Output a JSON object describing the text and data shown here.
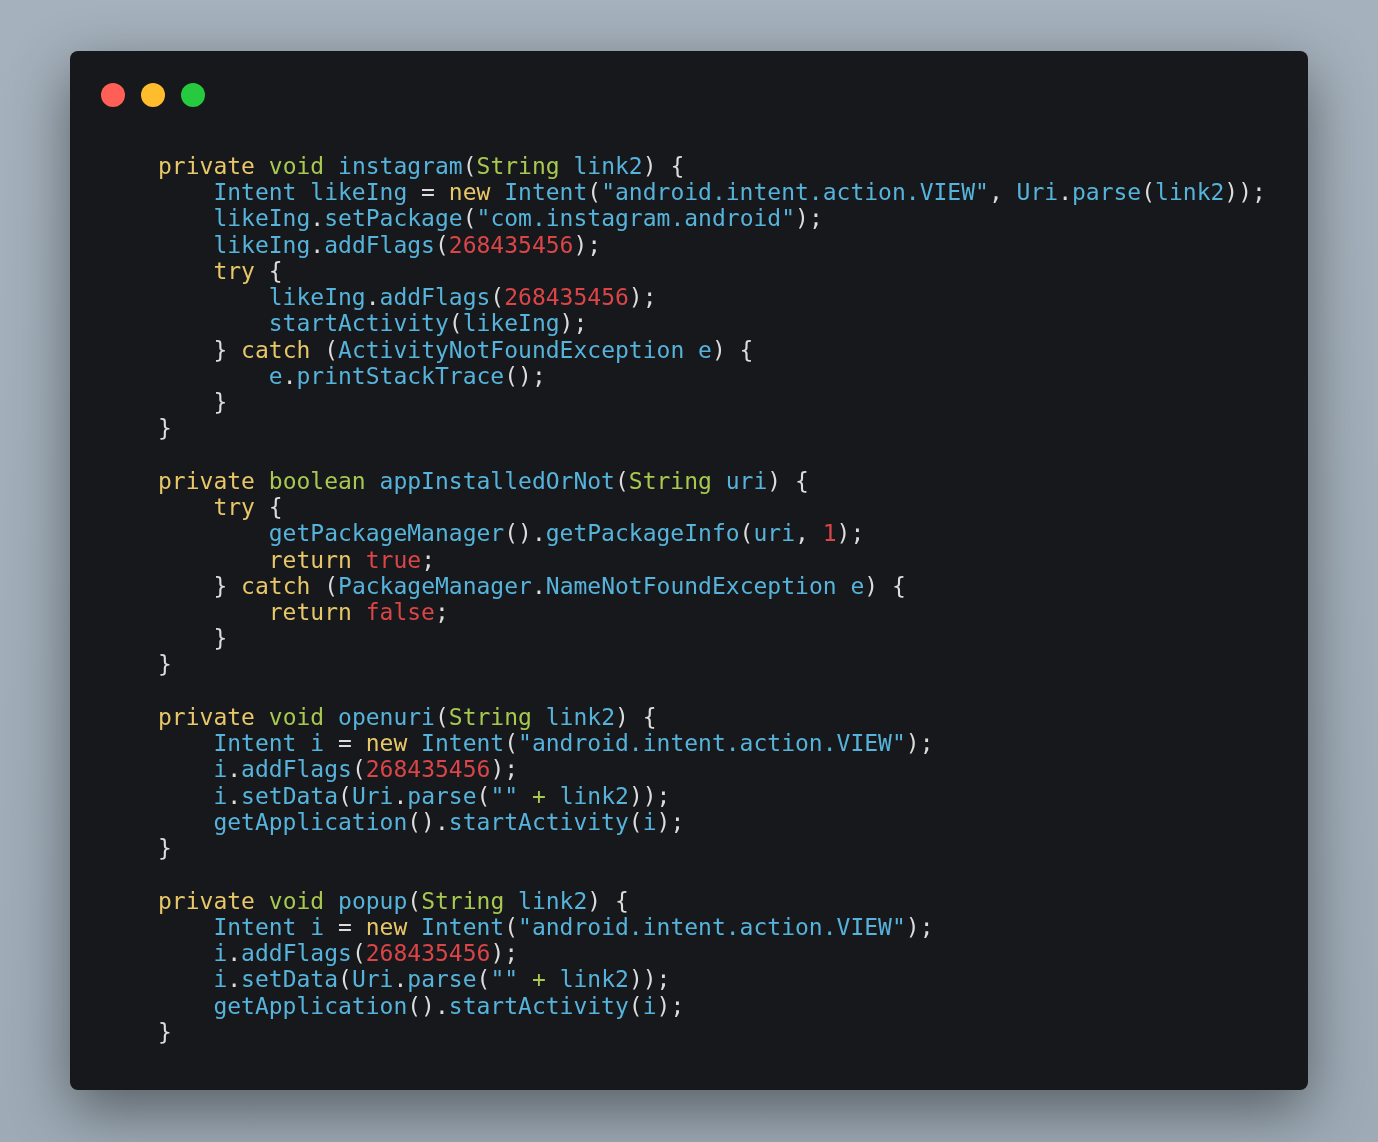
{
  "window": {
    "controls": [
      {
        "color": "#ff5f56"
      },
      {
        "color": "#ffbd2e"
      },
      {
        "color": "#27c93f"
      }
    ]
  },
  "code": {
    "lines": [
      {
        "kind": "code",
        "tokens": [
          {
            "kind": "keyword",
            "text": "private"
          },
          {
            "kind": "type",
            "text": " void"
          },
          {
            "kind": "name",
            "text": " instagram"
          },
          {
            "kind": "punct",
            "text": "("
          },
          {
            "kind": "type",
            "text": "String"
          },
          {
            "kind": "name",
            "text": " link2"
          },
          {
            "kind": "punct",
            "text": ") {"
          }
        ]
      },
      {
        "kind": "code",
        "tokens": [
          {
            "kind": "name",
            "text": "    Intent likeIng"
          },
          {
            "kind": "punct",
            "text": " = "
          },
          {
            "kind": "keyword",
            "text": "new"
          },
          {
            "kind": "name",
            "text": " Intent"
          },
          {
            "kind": "punct",
            "text": "("
          },
          {
            "kind": "string",
            "text": "\"android.intent.action.VIEW\""
          },
          {
            "kind": "punct",
            "text": ", "
          },
          {
            "kind": "name",
            "text": "Uri"
          },
          {
            "kind": "punct",
            "text": "."
          },
          {
            "kind": "name",
            "text": "parse"
          },
          {
            "kind": "punct",
            "text": "("
          },
          {
            "kind": "name",
            "text": "link2"
          },
          {
            "kind": "punct",
            "text": "));"
          }
        ]
      },
      {
        "kind": "code",
        "tokens": [
          {
            "kind": "name",
            "text": "    likeIng"
          },
          {
            "kind": "punct",
            "text": "."
          },
          {
            "kind": "name",
            "text": "setPackage"
          },
          {
            "kind": "punct",
            "text": "("
          },
          {
            "kind": "string",
            "text": "\"com.instagram.android\""
          },
          {
            "kind": "punct",
            "text": ");"
          }
        ]
      },
      {
        "kind": "code",
        "tokens": [
          {
            "kind": "name",
            "text": "    likeIng"
          },
          {
            "kind": "punct",
            "text": "."
          },
          {
            "kind": "name",
            "text": "addFlags"
          },
          {
            "kind": "punct",
            "text": "("
          },
          {
            "kind": "number",
            "text": "268435456"
          },
          {
            "kind": "punct",
            "text": ");"
          }
        ]
      },
      {
        "kind": "code",
        "tokens": [
          {
            "kind": "keyword",
            "text": "    try"
          },
          {
            "kind": "punct",
            "text": " {"
          }
        ]
      },
      {
        "kind": "code",
        "tokens": [
          {
            "kind": "name",
            "text": "        likeIng"
          },
          {
            "kind": "punct",
            "text": "."
          },
          {
            "kind": "name",
            "text": "addFlags"
          },
          {
            "kind": "punct",
            "text": "("
          },
          {
            "kind": "number",
            "text": "268435456"
          },
          {
            "kind": "punct",
            "text": ");"
          }
        ]
      },
      {
        "kind": "code",
        "tokens": [
          {
            "kind": "name",
            "text": "        startActivity"
          },
          {
            "kind": "punct",
            "text": "("
          },
          {
            "kind": "name",
            "text": "likeIng"
          },
          {
            "kind": "punct",
            "text": ");"
          }
        ]
      },
      {
        "kind": "code",
        "tokens": [
          {
            "kind": "punct",
            "text": "    } "
          },
          {
            "kind": "keyword",
            "text": "catch"
          },
          {
            "kind": "punct",
            "text": " ("
          },
          {
            "kind": "name",
            "text": "ActivityNotFoundException e"
          },
          {
            "kind": "punct",
            "text": ") {"
          }
        ]
      },
      {
        "kind": "code",
        "tokens": [
          {
            "kind": "name",
            "text": "        e"
          },
          {
            "kind": "punct",
            "text": "."
          },
          {
            "kind": "name",
            "text": "printStackTrace"
          },
          {
            "kind": "punct",
            "text": "();"
          }
        ]
      },
      {
        "kind": "code",
        "tokens": [
          {
            "kind": "punct",
            "text": "    }"
          }
        ]
      },
      {
        "kind": "code",
        "tokens": [
          {
            "kind": "punct",
            "text": "}"
          }
        ]
      },
      {
        "kind": "blank"
      },
      {
        "kind": "code",
        "tokens": [
          {
            "kind": "keyword",
            "text": "private"
          },
          {
            "kind": "type",
            "text": " boolean"
          },
          {
            "kind": "name",
            "text": " appInstalledOrNot"
          },
          {
            "kind": "punct",
            "text": "("
          },
          {
            "kind": "type",
            "text": "String"
          },
          {
            "kind": "name",
            "text": " uri"
          },
          {
            "kind": "punct",
            "text": ") {"
          }
        ]
      },
      {
        "kind": "code",
        "tokens": [
          {
            "kind": "keyword",
            "text": "    try"
          },
          {
            "kind": "punct",
            "text": " {"
          }
        ]
      },
      {
        "kind": "code",
        "tokens": [
          {
            "kind": "name",
            "text": "        getPackageManager"
          },
          {
            "kind": "punct",
            "text": "()."
          },
          {
            "kind": "name",
            "text": "getPackageInfo"
          },
          {
            "kind": "punct",
            "text": "("
          },
          {
            "kind": "name",
            "text": "uri"
          },
          {
            "kind": "punct",
            "text": ", "
          },
          {
            "kind": "number",
            "text": "1"
          },
          {
            "kind": "punct",
            "text": ");"
          }
        ]
      },
      {
        "kind": "code",
        "tokens": [
          {
            "kind": "keyword",
            "text": "        return"
          },
          {
            "kind": "number",
            "text": " true"
          },
          {
            "kind": "punct",
            "text": ";"
          }
        ]
      },
      {
        "kind": "code",
        "tokens": [
          {
            "kind": "punct",
            "text": "    } "
          },
          {
            "kind": "keyword",
            "text": "catch"
          },
          {
            "kind": "punct",
            "text": " ("
          },
          {
            "kind": "name",
            "text": "PackageManager"
          },
          {
            "kind": "punct",
            "text": "."
          },
          {
            "kind": "name",
            "text": "NameNotFoundException e"
          },
          {
            "kind": "punct",
            "text": ") {"
          }
        ]
      },
      {
        "kind": "code",
        "tokens": [
          {
            "kind": "keyword",
            "text": "        return"
          },
          {
            "kind": "number",
            "text": " false"
          },
          {
            "kind": "punct",
            "text": ";"
          }
        ]
      },
      {
        "kind": "code",
        "tokens": [
          {
            "kind": "punct",
            "text": "    }"
          }
        ]
      },
      {
        "kind": "code",
        "tokens": [
          {
            "kind": "punct",
            "text": "}"
          }
        ]
      },
      {
        "kind": "blank"
      },
      {
        "kind": "code",
        "tokens": [
          {
            "kind": "keyword",
            "text": "private"
          },
          {
            "kind": "type",
            "text": " void"
          },
          {
            "kind": "name",
            "text": " openuri"
          },
          {
            "kind": "punct",
            "text": "("
          },
          {
            "kind": "type",
            "text": "String"
          },
          {
            "kind": "name",
            "text": " link2"
          },
          {
            "kind": "punct",
            "text": ") {"
          }
        ]
      },
      {
        "kind": "code",
        "tokens": [
          {
            "kind": "name",
            "text": "    Intent i"
          },
          {
            "kind": "punct",
            "text": " = "
          },
          {
            "kind": "keyword",
            "text": "new"
          },
          {
            "kind": "name",
            "text": " Intent"
          },
          {
            "kind": "punct",
            "text": "("
          },
          {
            "kind": "string",
            "text": "\"android.intent.action.VIEW\""
          },
          {
            "kind": "punct",
            "text": ");"
          }
        ]
      },
      {
        "kind": "code",
        "tokens": [
          {
            "kind": "name",
            "text": "    i"
          },
          {
            "kind": "punct",
            "text": "."
          },
          {
            "kind": "name",
            "text": "addFlags"
          },
          {
            "kind": "punct",
            "text": "("
          },
          {
            "kind": "number",
            "text": "268435456"
          },
          {
            "kind": "punct",
            "text": ");"
          }
        ]
      },
      {
        "kind": "code",
        "tokens": [
          {
            "kind": "name",
            "text": "    i"
          },
          {
            "kind": "punct",
            "text": "."
          },
          {
            "kind": "name",
            "text": "setData"
          },
          {
            "kind": "punct",
            "text": "("
          },
          {
            "kind": "name",
            "text": "Uri"
          },
          {
            "kind": "punct",
            "text": "."
          },
          {
            "kind": "name",
            "text": "parse"
          },
          {
            "kind": "punct",
            "text": "("
          },
          {
            "kind": "string",
            "text": "\"\""
          },
          {
            "kind": "operator",
            "text": " + "
          },
          {
            "kind": "name",
            "text": "link2"
          },
          {
            "kind": "punct",
            "text": "));"
          }
        ]
      },
      {
        "kind": "code",
        "tokens": [
          {
            "kind": "name",
            "text": "    getApplication"
          },
          {
            "kind": "punct",
            "text": "()."
          },
          {
            "kind": "name",
            "text": "startActivity"
          },
          {
            "kind": "punct",
            "text": "("
          },
          {
            "kind": "name",
            "text": "i"
          },
          {
            "kind": "punct",
            "text": ");"
          }
        ]
      },
      {
        "kind": "code",
        "tokens": [
          {
            "kind": "punct",
            "text": "}"
          }
        ]
      },
      {
        "kind": "blank"
      },
      {
        "kind": "code",
        "tokens": [
          {
            "kind": "keyword",
            "text": "private"
          },
          {
            "kind": "type",
            "text": " void"
          },
          {
            "kind": "name",
            "text": " popup"
          },
          {
            "kind": "punct",
            "text": "("
          },
          {
            "kind": "type",
            "text": "String"
          },
          {
            "kind": "name",
            "text": " link2"
          },
          {
            "kind": "punct",
            "text": ") {"
          }
        ]
      },
      {
        "kind": "code",
        "tokens": [
          {
            "kind": "name",
            "text": "    Intent i"
          },
          {
            "kind": "punct",
            "text": " = "
          },
          {
            "kind": "keyword",
            "text": "new"
          },
          {
            "kind": "name",
            "text": " Intent"
          },
          {
            "kind": "punct",
            "text": "("
          },
          {
            "kind": "string",
            "text": "\"android.intent.action.VIEW\""
          },
          {
            "kind": "punct",
            "text": ");"
          }
        ]
      },
      {
        "kind": "code",
        "tokens": [
          {
            "kind": "name",
            "text": "    i"
          },
          {
            "kind": "punct",
            "text": "."
          },
          {
            "kind": "name",
            "text": "addFlags"
          },
          {
            "kind": "punct",
            "text": "("
          },
          {
            "kind": "number",
            "text": "268435456"
          },
          {
            "kind": "punct",
            "text": ");"
          }
        ]
      },
      {
        "kind": "code",
        "tokens": [
          {
            "kind": "name",
            "text": "    i"
          },
          {
            "kind": "punct",
            "text": "."
          },
          {
            "kind": "name",
            "text": "setData"
          },
          {
            "kind": "punct",
            "text": "("
          },
          {
            "kind": "name",
            "text": "Uri"
          },
          {
            "kind": "punct",
            "text": "."
          },
          {
            "kind": "name",
            "text": "parse"
          },
          {
            "kind": "punct",
            "text": "("
          },
          {
            "kind": "string",
            "text": "\"\""
          },
          {
            "kind": "operator",
            "text": " + "
          },
          {
            "kind": "name",
            "text": "link2"
          },
          {
            "kind": "punct",
            "text": "));"
          }
        ]
      },
      {
        "kind": "code",
        "tokens": [
          {
            "kind": "name",
            "text": "    getApplication"
          },
          {
            "kind": "punct",
            "text": "()."
          },
          {
            "kind": "name",
            "text": "startActivity"
          },
          {
            "kind": "punct",
            "text": "("
          },
          {
            "kind": "name",
            "text": "i"
          },
          {
            "kind": "punct",
            "text": ");"
          }
        ]
      },
      {
        "kind": "code",
        "tokens": [
          {
            "kind": "punct",
            "text": "}"
          }
        ]
      }
    ]
  }
}
